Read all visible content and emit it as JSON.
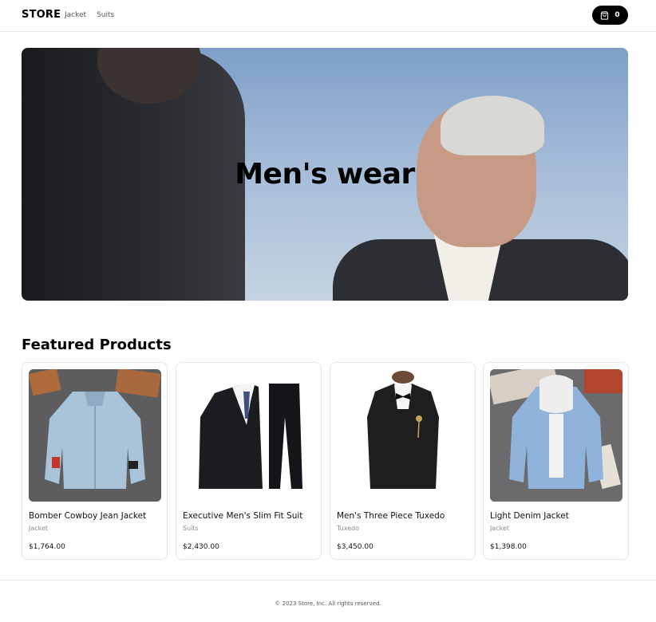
{
  "header": {
    "logo": "STORE",
    "nav": [
      "Jacket",
      "Suits"
    ],
    "cart_count": "0"
  },
  "hero": {
    "title": "Men's wear"
  },
  "featured": {
    "title": "Featured Products",
    "products": [
      {
        "name": "Bomber Cowboy Jean Jacket",
        "category": "Jacket",
        "price": "$1,764.00"
      },
      {
        "name": "Executive Men's Slim Fit Suit",
        "category": "Suits",
        "price": "$2,430.00"
      },
      {
        "name": "Men's Three Piece Tuxedo",
        "category": "Tuxedo",
        "price": "$3,450.00"
      },
      {
        "name": "Light Denim Jacket",
        "category": "Jacket",
        "price": "$1,398.00"
      }
    ]
  },
  "footer": {
    "text": "© 2023 Store, Inc. All rights reserved."
  },
  "colors": {
    "accent": "#000000",
    "border": "#e5e5e5",
    "muted_text": "#8a8a8a"
  },
  "icons": {
    "cart": "shopping-bag-icon"
  }
}
